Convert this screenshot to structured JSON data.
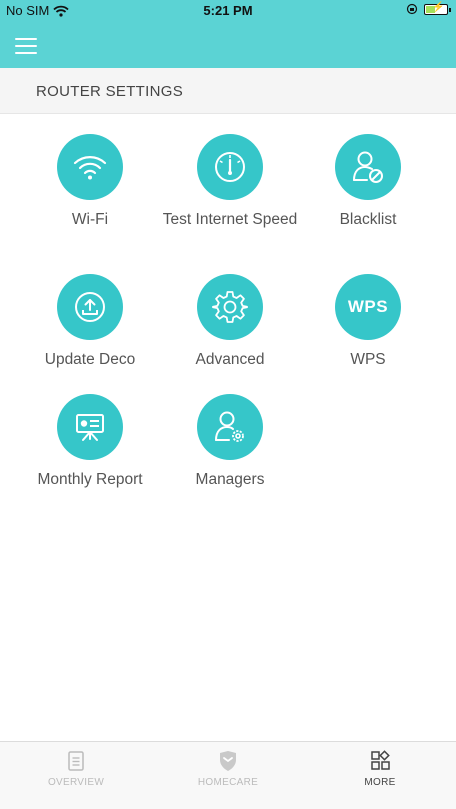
{
  "status_bar": {
    "carrier": "No SIM",
    "time": "5:21 PM"
  },
  "header": {
    "section_title": "ROUTER SETTINGS"
  },
  "items": [
    {
      "label": "Wi-Fi",
      "icon": "wifi-icon"
    },
    {
      "label": "Test Internet Speed",
      "icon": "speed-gauge-icon"
    },
    {
      "label": "Blacklist",
      "icon": "user-blocked-icon"
    },
    {
      "label": "Update Deco",
      "icon": "upload-icon"
    },
    {
      "label": "Advanced",
      "icon": "gear-icon"
    },
    {
      "label": "WPS",
      "icon": "wps-icon"
    },
    {
      "label": "Monthly Report",
      "icon": "presentation-board-icon"
    },
    {
      "label": "Managers",
      "icon": "user-settings-icon"
    }
  ],
  "tabbar": {
    "tabs": [
      {
        "label": "OVERVIEW",
        "icon": "document-icon",
        "active": false
      },
      {
        "label": "HOMECARE",
        "icon": "shield-icon",
        "active": false
      },
      {
        "label": "MORE",
        "icon": "grid-icon",
        "active": true
      }
    ]
  },
  "wps_text": "WPS",
  "colors": {
    "header": "#5bd3d4",
    "accent": "#36c6c9"
  }
}
